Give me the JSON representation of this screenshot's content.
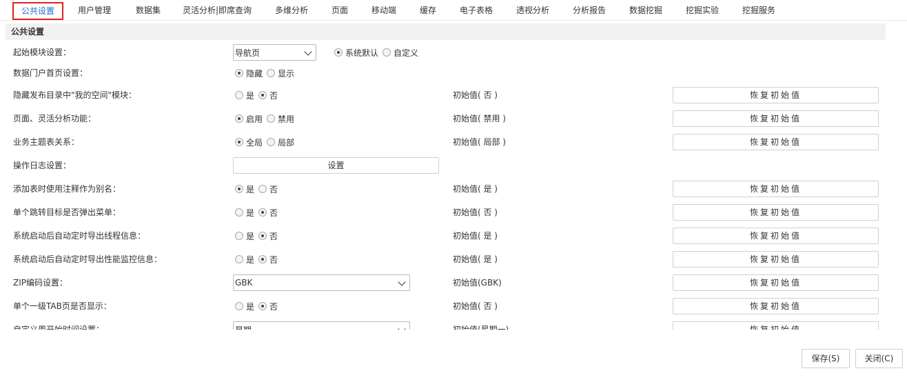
{
  "tabs": [
    {
      "label": "公共设置",
      "active": true
    },
    {
      "label": "用户管理"
    },
    {
      "label": "数据集"
    },
    {
      "label": "灵活分析|即席查询"
    },
    {
      "label": "多维分析"
    },
    {
      "label": "页面"
    },
    {
      "label": "移动端"
    },
    {
      "label": "缓存"
    },
    {
      "label": "电子表格"
    },
    {
      "label": "透视分析"
    },
    {
      "label": "分析报告"
    },
    {
      "label": "数据挖掘"
    },
    {
      "label": "挖掘实验"
    },
    {
      "label": "挖掘服务"
    }
  ],
  "section": {
    "title": "公共设置"
  },
  "restore_label": "恢复初始值",
  "rows": [
    {
      "label": "起始模块设置：",
      "select_value": "导航页",
      "radios": [
        {
          "label": "系统默认",
          "checked": true
        },
        {
          "label": "自定义",
          "checked": false
        }
      ]
    },
    {
      "label": "数据门户首页设置：",
      "radios": [
        {
          "label": "隐藏",
          "checked": true
        },
        {
          "label": "显示",
          "checked": false
        }
      ]
    },
    {
      "label": "隐藏发布目录中\"我的空间\"模块：",
      "radios": [
        {
          "label": "是",
          "checked": false
        },
        {
          "label": "否",
          "checked": true
        }
      ],
      "initial": "初始值( 否 )"
    },
    {
      "label": "页面、灵活分析功能：",
      "radios": [
        {
          "label": "启用",
          "checked": true
        },
        {
          "label": "禁用",
          "checked": false
        }
      ],
      "initial": "初始值( 禁用 )"
    },
    {
      "label": "业务主题表关系：",
      "radios": [
        {
          "label": "全局",
          "checked": true
        },
        {
          "label": "局部",
          "checked": false
        }
      ],
      "initial": "初始值( 局部 )"
    },
    {
      "label": "操作日志设置：",
      "button": "设置"
    },
    {
      "label": "添加表时使用注释作为别名：",
      "radios": [
        {
          "label": "是",
          "checked": true
        },
        {
          "label": "否",
          "checked": false
        }
      ],
      "initial": "初始值( 是 )"
    },
    {
      "label": "单个跳转目标是否弹出菜单：",
      "radios": [
        {
          "label": "是",
          "checked": false
        },
        {
          "label": "否",
          "checked": true
        }
      ],
      "initial": "初始值( 否 )"
    },
    {
      "label": "系统启动后自动定时导出线程信息：",
      "radios": [
        {
          "label": "是",
          "checked": false
        },
        {
          "label": "否",
          "checked": true
        }
      ],
      "initial": "初始值( 是 )"
    },
    {
      "label": "系统启动后自动定时导出性能监控信息：",
      "radios": [
        {
          "label": "是",
          "checked": false
        },
        {
          "label": "否",
          "checked": true
        }
      ],
      "initial": "初始值( 是 )"
    },
    {
      "label": "ZIP编码设置：",
      "select_value": "GBK",
      "initial": "初始值(GBK)"
    },
    {
      "label": "单个一级TAB页是否显示：",
      "radios": [
        {
          "label": "是",
          "checked": false
        },
        {
          "label": "否",
          "checked": true
        }
      ],
      "initial": "初始值( 否 )"
    },
    {
      "label": "自定义周开始时间设置：",
      "select_value": "星期一",
      "initial": "初始值(星期一)"
    }
  ],
  "footer": {
    "save": "保存(S)",
    "close": "关闭(C)"
  }
}
